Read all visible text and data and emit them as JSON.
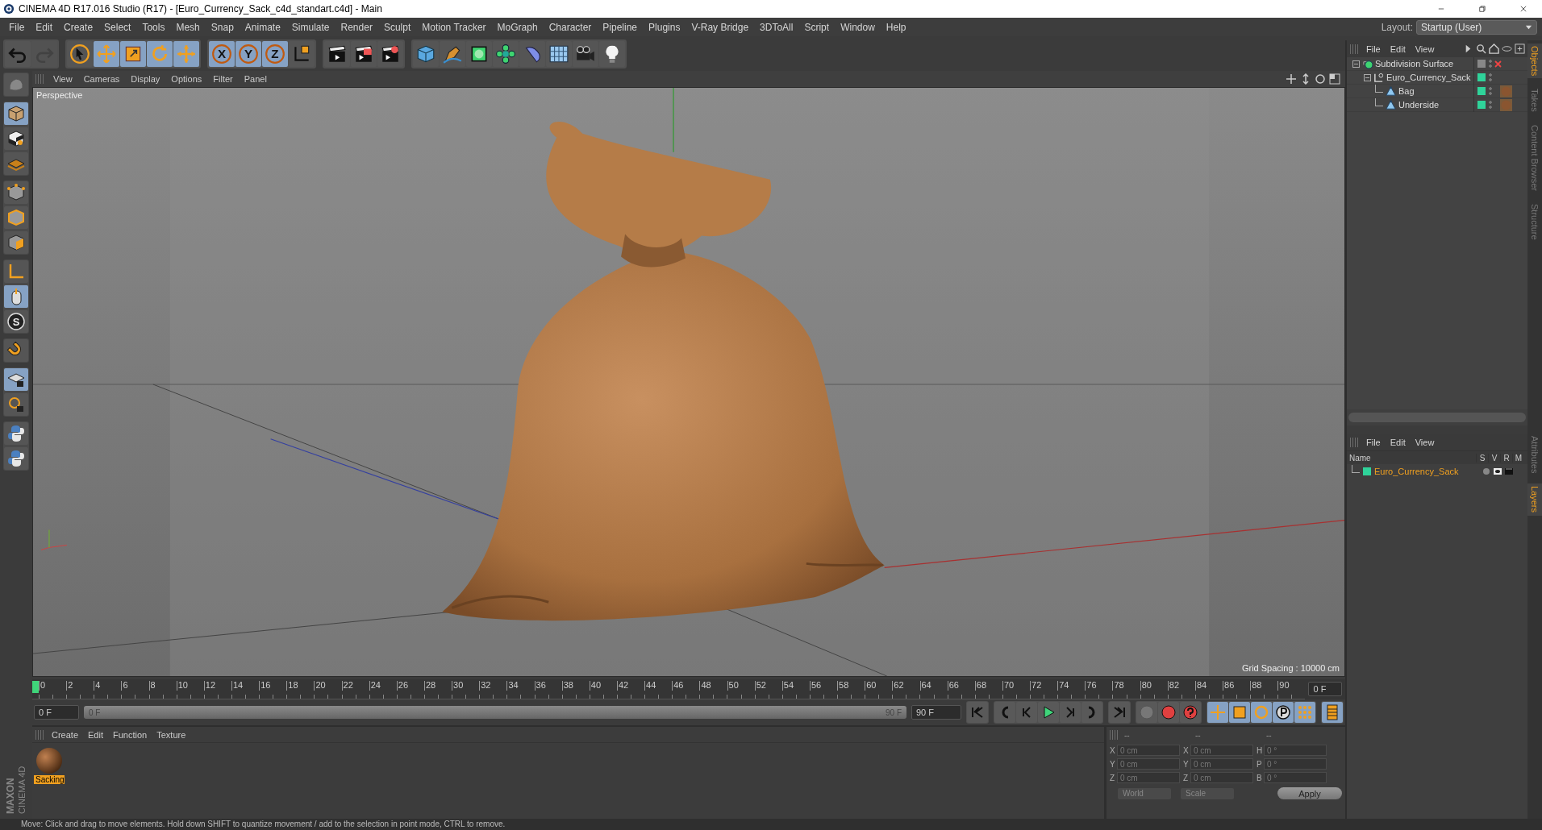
{
  "window": {
    "title": "CINEMA 4D R17.016 Studio (R17) - [Euro_Currency_Sack_c4d_standart.c4d] - Main"
  },
  "menu": [
    "File",
    "Edit",
    "Create",
    "Select",
    "Tools",
    "Mesh",
    "Snap",
    "Animate",
    "Simulate",
    "Render",
    "Sculpt",
    "Motion Tracker",
    "MoGraph",
    "Character",
    "Pipeline",
    "Plugins",
    "V-Ray Bridge",
    "3DToAll",
    "Script",
    "Window",
    "Help"
  ],
  "layout": {
    "label": "Layout:",
    "value": "Startup (User)"
  },
  "toolbar": [
    [
      {
        "selected": false,
        "disabled": false
      },
      {
        "selected": false,
        "disabled": true
      }
    ],
    [
      {
        "selected": false,
        "disabled": false
      },
      {
        "selected": true,
        "disabled": false
      },
      {
        "selected": true,
        "disabled": false
      },
      {
        "selected": true,
        "disabled": false
      },
      {
        "selected": true,
        "disabled": false
      }
    ],
    [
      {
        "selected": true,
        "disabled": false,
        "label": "X"
      },
      {
        "selected": true,
        "disabled": false,
        "label": "Y"
      },
      {
        "selected": true,
        "disabled": false,
        "label": "Z"
      },
      {
        "selected": false,
        "disabled": false
      }
    ],
    [
      {
        "selected": false,
        "disabled": false
      },
      {
        "selected": false,
        "disabled": false
      },
      {
        "selected": false,
        "disabled": false
      }
    ],
    [
      {
        "selected": false,
        "disabled": false
      },
      {
        "selected": false,
        "disabled": false
      },
      {
        "selected": false,
        "disabled": false
      },
      {
        "selected": false,
        "disabled": false
      },
      {
        "selected": false,
        "disabled": false
      },
      {
        "selected": false,
        "disabled": false
      },
      {
        "selected": false,
        "disabled": false
      },
      {
        "selected": false,
        "disabled": false
      }
    ]
  ],
  "left_toolbar": [
    [
      {
        "selected": false
      }
    ],
    [
      {
        "selected": true
      },
      {
        "selected": false
      },
      {
        "selected": false
      }
    ],
    [
      {
        "selected": false
      },
      {
        "selected": false
      },
      {
        "selected": false
      }
    ],
    [
      {
        "selected": false
      },
      {
        "selected": true
      },
      {
        "selected": false,
        "label": "S"
      }
    ],
    [
      {
        "selected": false
      }
    ],
    [
      {
        "selected": true
      },
      {
        "selected": false
      }
    ],
    [
      {
        "selected": false
      },
      {
        "selected": false
      }
    ]
  ],
  "viewport": {
    "menu": [
      "View",
      "Cameras",
      "Display",
      "Options",
      "Filter",
      "Panel"
    ],
    "label": "Perspective",
    "grid_spacing": "Grid Spacing : 10000 cm"
  },
  "timeline": {
    "ticks": [
      "0",
      "2",
      "4",
      "6",
      "8",
      "10",
      "12",
      "14",
      "16",
      "18",
      "20",
      "22",
      "24",
      "26",
      "28",
      "30",
      "32",
      "34",
      "36",
      "38",
      "40",
      "42",
      "44",
      "46",
      "48",
      "50",
      "52",
      "54",
      "56",
      "58",
      "60",
      "62",
      "64",
      "66",
      "68",
      "70",
      "72",
      "74",
      "76",
      "78",
      "80",
      "82",
      "84",
      "86",
      "88",
      "90"
    ],
    "current_frame": "0 F"
  },
  "playback": {
    "start": "0 F",
    "range_start": "0 F",
    "range_end": "90 F",
    "end": "90 F",
    "level": 1
  },
  "materials": {
    "menu": [
      "Create",
      "Edit",
      "Function",
      "Texture"
    ],
    "items": [
      {
        "name": "Sacking",
        "selected": true
      }
    ]
  },
  "coordinates": {
    "headers": [
      "--",
      "--",
      "--"
    ],
    "rows": [
      {
        "axis": "X",
        "position": "0 cm",
        "size_axis": "X",
        "size": "0 cm",
        "rotation_axis": "H",
        "rotation": "0 °"
      },
      {
        "axis": "Y",
        "position": "0 cm",
        "size_axis": "Y",
        "size": "0 cm",
        "rotation_axis": "P",
        "rotation": "0 °"
      },
      {
        "axis": "Z",
        "position": "0 cm",
        "size_axis": "Z",
        "size": "0 cm",
        "rotation_axis": "B",
        "rotation": "0 °"
      }
    ],
    "dropdowns": [
      "World",
      "Scale"
    ],
    "apply": "Apply"
  },
  "objects": {
    "menu": [
      "File",
      "Edit",
      "View"
    ],
    "tree": [
      {
        "name": "Subdivision Surface",
        "kind": "generator",
        "material": false,
        "children": [
          {
            "name": "Euro_Currency_Sack",
            "kind": "null",
            "material": false,
            "children": [
              {
                "name": "Bag",
                "kind": "polygon",
                "material": true
              },
              {
                "name": "Underside",
                "kind": "polygon",
                "material": true
              }
            ]
          }
        ]
      }
    ]
  },
  "layers": {
    "menu": [
      "File",
      "Edit",
      "View"
    ],
    "columns": [
      "Name",
      "S",
      "V",
      "R",
      "M"
    ],
    "rows": [
      {
        "name": "Euro_Currency_Sack",
        "color": "#2fd39a",
        "selected": true
      }
    ]
  },
  "side_tabs_top": [
    {
      "label": "Objects",
      "selected": true
    },
    {
      "label": "Takes",
      "selected": false
    },
    {
      "label": "Content Browser",
      "selected": false
    },
    {
      "label": "Structure",
      "selected": false
    }
  ],
  "side_tabs_bottom": [
    {
      "label": "Attributes",
      "selected": false
    },
    {
      "label": "Layers",
      "selected": true
    }
  ],
  "logo": [
    "MAXON",
    "CINEMA 4D"
  ],
  "status_bar": "Move: Click and drag to move elements. Hold down SHIFT to quantize movement / add to the selection in point mode, CTRL to remove."
}
